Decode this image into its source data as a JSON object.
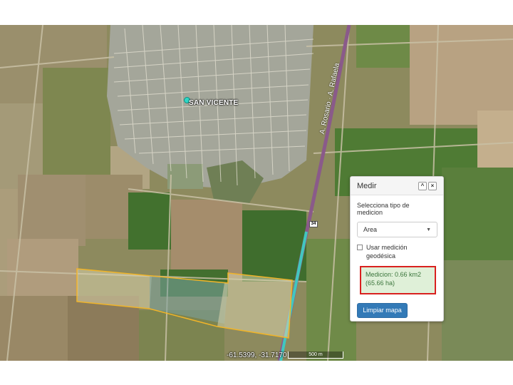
{
  "map": {
    "town_label": "SAN VICENTE",
    "route_name": "A. Rafaela",
    "route_name_2": "A. Rosario",
    "route_shield": "34",
    "coordinates": "-61.5399, -31.7170",
    "scale_label": "500 m",
    "polygon_color": "#f0b429"
  },
  "measure_panel": {
    "title": "Medir",
    "minimize_glyph": "^",
    "close_glyph": "×",
    "type_label": "Selecciona tipo de medicion",
    "type_selected": "Area",
    "geodesic_label": "Usar medición geodésica",
    "geodesic_checked": false,
    "result_line1": "Medicion: 0.66 km2",
    "result_line2": "(65.66 ha)",
    "clear_button": "Limpiar mapa",
    "accent_color": "#337ab7",
    "highlight_color": "#d9211f"
  }
}
